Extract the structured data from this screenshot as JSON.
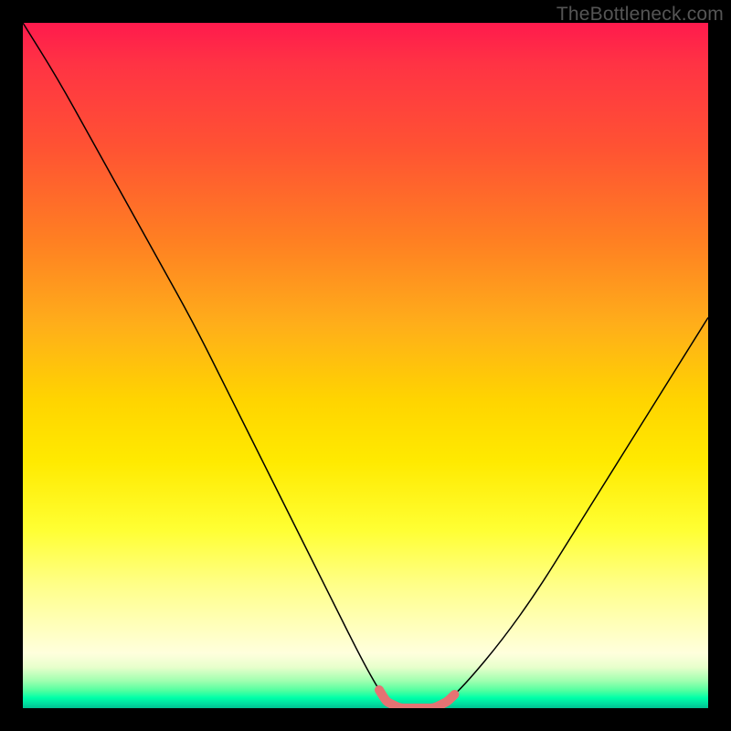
{
  "attribution": "TheBottleneck.com",
  "chart_data": {
    "type": "line",
    "title": "",
    "xlabel": "",
    "ylabel": "",
    "xlim": [
      0,
      100
    ],
    "ylim": [
      0,
      100
    ],
    "x": [
      0,
      5,
      10,
      15,
      20,
      25,
      30,
      35,
      40,
      45,
      50,
      53,
      55,
      57,
      60,
      62,
      65,
      70,
      75,
      80,
      85,
      90,
      95,
      100
    ],
    "values": [
      100,
      92,
      83,
      74,
      65,
      56,
      46,
      36,
      26,
      16,
      6,
      1,
      0,
      0,
      0,
      1,
      4,
      10,
      17,
      25,
      33,
      41,
      49,
      57
    ],
    "highlight_x_range": [
      52,
      63
    ],
    "series": [
      {
        "name": "curve",
        "stroke": "#000000",
        "stroke_width": 1.5
      }
    ],
    "highlight_style": {
      "stroke": "#e57373",
      "stroke_width": 10
    }
  }
}
